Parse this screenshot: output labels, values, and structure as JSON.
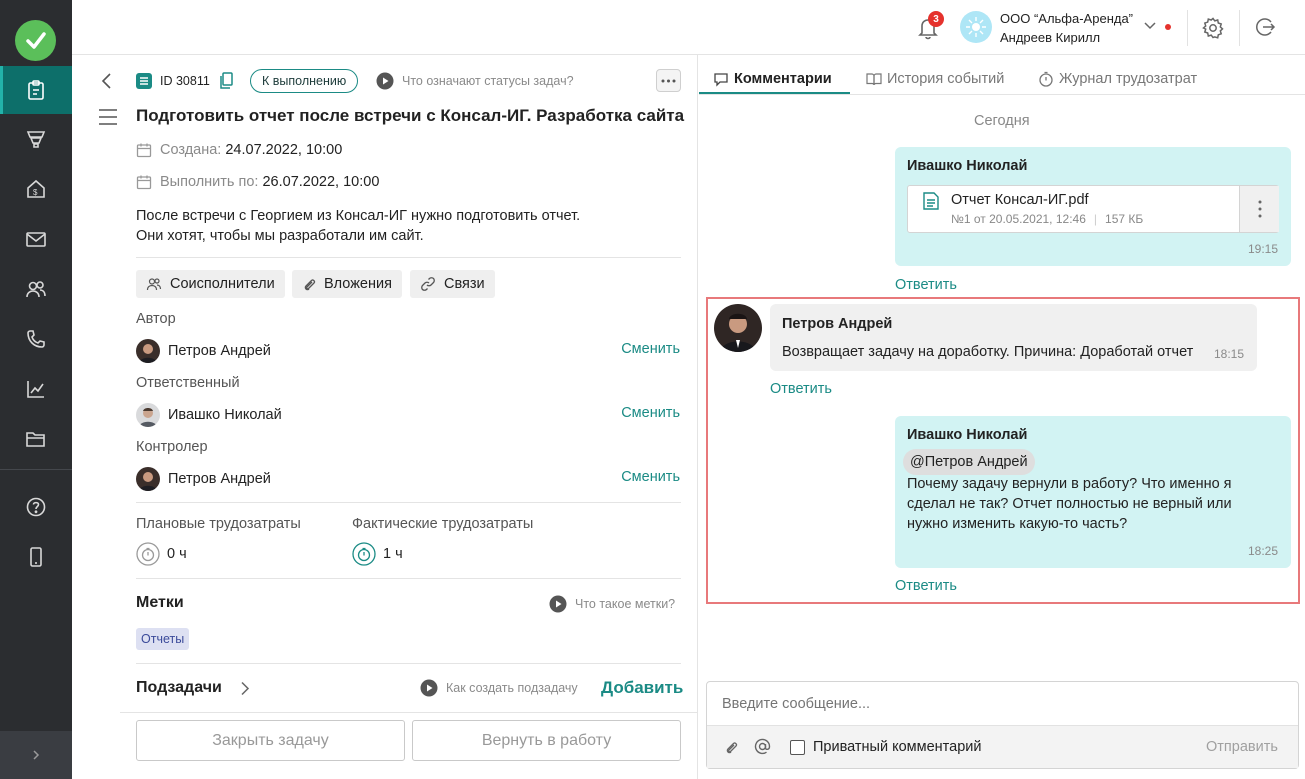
{
  "brand": {
    "accent": "#1b8b85",
    "sidebar_bg": "#2b2d30",
    "highlight": "#e8797b"
  },
  "sidebar": {
    "items": [
      {
        "icon": "clipboard-icon",
        "active": true
      },
      {
        "icon": "funnel-icon",
        "active": false
      },
      {
        "icon": "house-dollar-icon",
        "active": false
      },
      {
        "icon": "mail-icon",
        "active": false
      },
      {
        "icon": "users-icon",
        "active": false
      },
      {
        "icon": "phone-icon",
        "active": false
      },
      {
        "icon": "chart-icon",
        "active": false
      },
      {
        "icon": "folder-icon",
        "active": false
      },
      {
        "icon": "help-icon",
        "active": false
      },
      {
        "icon": "mobile-icon",
        "active": false
      }
    ]
  },
  "topbar": {
    "notifications_count": "3",
    "company": "ООО “Альфа-Аренда”",
    "user": "Андреев Кирилл"
  },
  "task": {
    "id": "ID 30811",
    "status": "К выполнению",
    "status_help": "Что означают статусы задач?",
    "title": "Подготовить отчет после встречи с Консал-ИГ. Разработка сайта",
    "created_label": "Создана:",
    "created_value": "24.07.2022, 10:00",
    "due_label": "Выполнить по:",
    "due_value": "26.07.2022, 10:00",
    "description_line1": "После встречи с Георгием из Консал-ИГ нужно подготовить отчет.",
    "description_line2": "Они хотят, чтобы мы разработали им сайт.",
    "chips": {
      "coexecutors": "Соисполнители",
      "attachments": "Вложения",
      "links": "Связи"
    },
    "author_label": "Автор",
    "author": "Петров Андрей",
    "responsible_label": "Ответственный",
    "responsible": "Ивашко Николай",
    "controller_label": "Контролер",
    "controller": "Петров Андрей",
    "change_link": "Сменить",
    "planned_label": "Плановые трудозатраты",
    "planned_value": "0 ч",
    "actual_label": "Фактические трудозатраты",
    "actual_value": "1 ч",
    "tags_title": "Метки",
    "tags_help": "Что такое метки?",
    "tag": "Отчеты",
    "subtasks_title": "Подзадачи",
    "subtasks_help": "Как создать подзадачу",
    "subtasks_add": "Добавить",
    "close_button": "Закрыть задачу",
    "return_button": "Вернуть в работу"
  },
  "tabs": {
    "comments": "Комментарии",
    "history": "История событий",
    "timelog": "Журнал трудозатрат"
  },
  "comments": {
    "day": "Сегодня",
    "reply": "Ответить",
    "c1": {
      "author": "Ивашко Николай",
      "file_name": "Отчет Консал-ИГ.pdf",
      "file_meta": "№1 от 20.05.2021, 12:46",
      "file_size": "157 КБ",
      "time": "19:15"
    },
    "c2": {
      "author": "Петров Андрей",
      "text": "Возвращает задачу на доработку. Причина: Доработай отчет",
      "time": "18:15"
    },
    "c3": {
      "author": "Ивашко Николай",
      "mention": "@Петров Андрей",
      "line1": "Почему задачу вернули в работу? Что именно я",
      "line2": "сделал не так? Отчет полностью не верный или",
      "line3": "нужно изменить какую-то часть?",
      "time": "18:25"
    }
  },
  "composer": {
    "placeholder": "Введите сообщение...",
    "private_label": "Приватный комментарий",
    "send": "Отправить"
  }
}
